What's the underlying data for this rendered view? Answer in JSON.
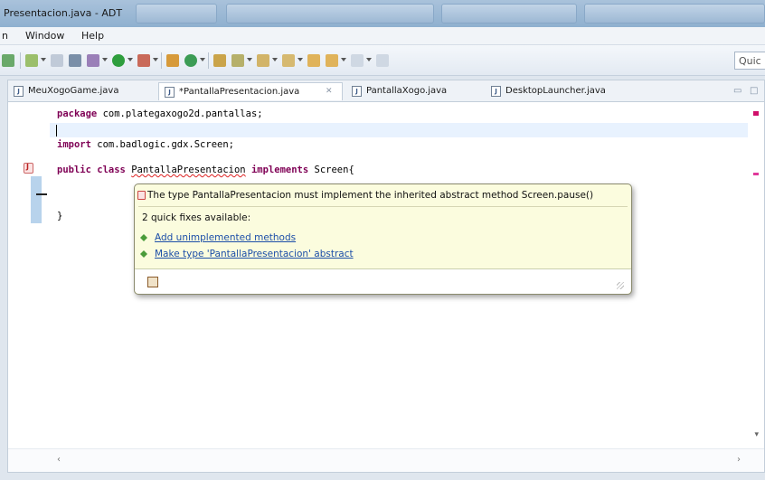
{
  "window": {
    "title": "Presentacion.java - ADT"
  },
  "menu": {
    "items": [
      {
        "label": "Window"
      },
      {
        "label": "Help"
      }
    ]
  },
  "toolbar": {
    "quick_access_label": "Quic"
  },
  "tabs": [
    {
      "label": "MeuXogoGame.java",
      "active": false
    },
    {
      "label": "*PantallaPresentacion.java",
      "active": true
    },
    {
      "label": "PantallaXogo.java",
      "active": false
    },
    {
      "label": "DesktopLauncher.java",
      "active": false
    }
  ],
  "editor": {
    "lines": [
      {
        "kw": "package",
        "rest": " com.plategaxogo2d.pantallas;"
      },
      {
        "kw": "import",
        "rest": " com.badlogic.gdx.Screen;"
      },
      {
        "kw1": "public",
        "kw2": "class",
        "cls": "PantallaPresentacion",
        "kw3": "implements",
        "rest": " Screen{"
      },
      {
        "rest": "}"
      }
    ]
  },
  "quickfix": {
    "message": "The type PantallaPresentacion must implement the inherited abstract method Screen.pause()",
    "subtitle": "2 quick fixes available:",
    "fixes": [
      {
        "label": "Add unimplemented methods"
      },
      {
        "label": "Make type 'PantallaPresentacion' abstract"
      }
    ]
  },
  "colors": {
    "keyword": "#7f0055",
    "link": "#1c4ea8",
    "popup_bg": "#fbfcde",
    "current_line": "#e8f2fe"
  }
}
